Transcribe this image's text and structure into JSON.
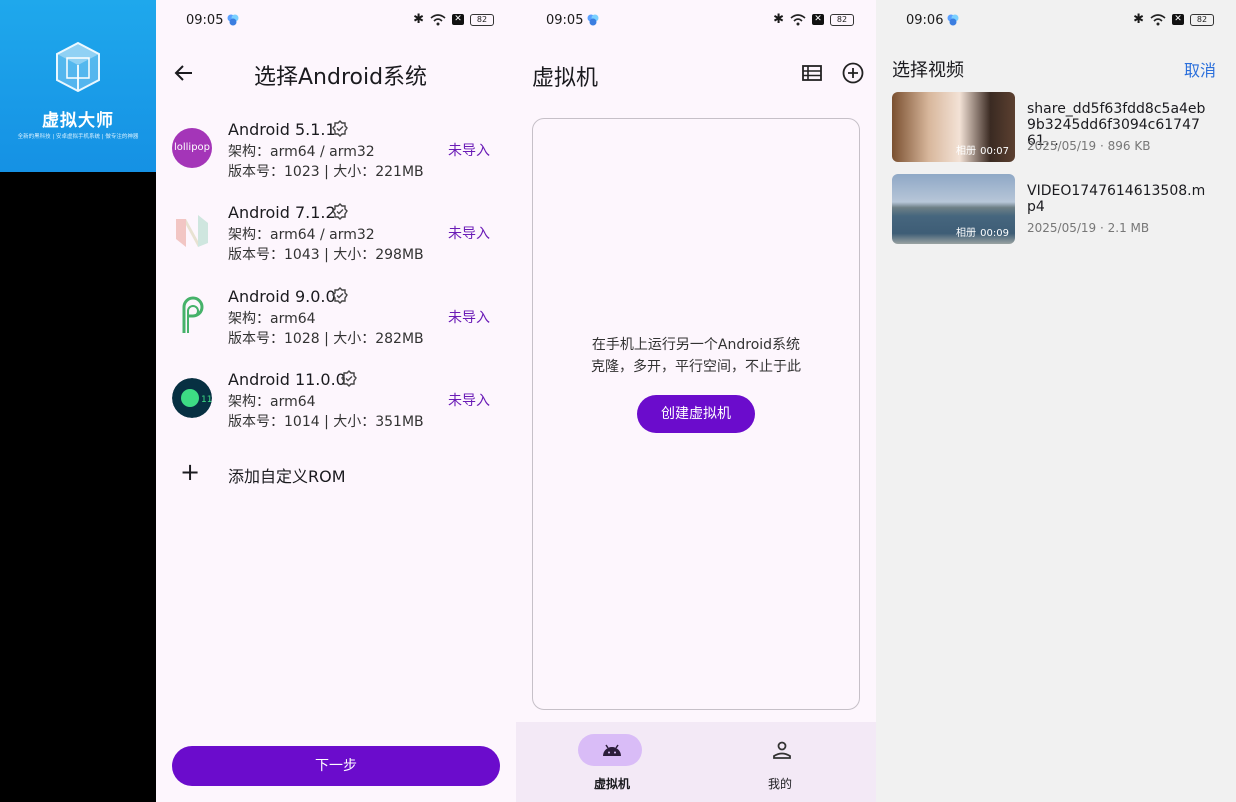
{
  "splash": {
    "app_name": "虚拟大师",
    "slogan": "全新的黑科技 | 安卓虚拟手机系统 | 做专注的神器",
    "brand_color": "#1a9ce8"
  },
  "status_bars": [
    {
      "time": "09:05",
      "battery": "82"
    },
    {
      "time": "09:05",
      "battery": "82"
    },
    {
      "time": "09:06",
      "battery": "82"
    }
  ],
  "select_android": {
    "title": "选择Android系统",
    "roms": [
      {
        "name": "Android 5.1.1",
        "arch": "架构：arm64 / arm32",
        "version": "版本号：1023 | 大小：221MB",
        "status": "未导入",
        "icon": "lollipop-icon"
      },
      {
        "name": "Android 7.1.2",
        "arch": "架构：arm64 / arm32",
        "version": "版本号：1043 | 大小：298MB",
        "status": "未导入",
        "icon": "nougat-icon"
      },
      {
        "name": "Android 9.0.0",
        "arch": "架构：arm64",
        "version": "版本号：1028 | 大小：282MB",
        "status": "未导入",
        "icon": "pie-icon"
      },
      {
        "name": "Android 11.0.0",
        "arch": "架构：arm64",
        "version": "版本号：1014 | 大小：351MB",
        "status": "未导入",
        "icon": "android11-icon"
      }
    ],
    "add_custom_rom": "添加自定义ROM",
    "next_label": "下一步",
    "accent_color": "#6b0ccc"
  },
  "vm_list": {
    "title": "虚拟机",
    "empty_line1": "在手机上运行另一个Android系统",
    "empty_line2": "克隆，多开，平行空间，不止于此",
    "create_label": "创建虚拟机",
    "nav": [
      {
        "label": "虚拟机",
        "icon": "android-icon",
        "selected": true
      },
      {
        "label": "我的",
        "icon": "person-icon",
        "selected": false
      }
    ]
  },
  "select_video": {
    "title": "选择视频",
    "cancel_label": "取消",
    "videos": [
      {
        "file_name": "share_dd5f63fdd8c5a4eb9b3245dd6f3094c6174761…",
        "date": "2025/05/19",
        "size": "896 KB",
        "album_tag": "相册",
        "duration": "00:07"
      },
      {
        "file_name": "VIDEO1747614613508.mp4",
        "date": "2025/05/19",
        "size": "2.1 MB",
        "album_tag": "相册",
        "duration": "00:09"
      }
    ]
  }
}
